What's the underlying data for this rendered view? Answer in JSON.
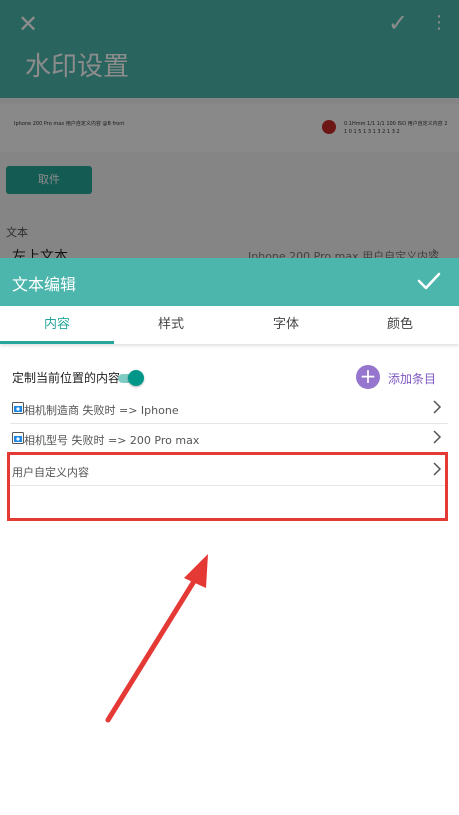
{
  "background_page": {
    "title": "水印设置",
    "preview_left_text": "Iphone 200 Pro max 用户自定义内容 @B front",
    "preview_right_text": "0.1Hmm 1/1 1/1 100 ISO 用户自定义内容 2 1 0 1 5 1 3 1 3 2 1 3 2",
    "button_label": "取件",
    "section_label": "文本",
    "row_label": "左上文本",
    "row_value": "Iphone 200 Pro max 用户自定义内容"
  },
  "sheet": {
    "title": "文本编辑",
    "tabs": [
      {
        "label": "内容",
        "active": true
      },
      {
        "label": "样式",
        "active": false
      },
      {
        "label": "字体",
        "active": false
      },
      {
        "label": "颜色",
        "active": false
      }
    ],
    "customize_label": "定制当前位置的内容",
    "customize_enabled": true,
    "add_item_label": "添加条目",
    "items": [
      {
        "text": "相机制造商 失败时 => Iphone",
        "icon": "camera-tag-icon"
      },
      {
        "text": "相机型号 失败时 => 200 Pro max",
        "icon": "camera-tag-icon"
      },
      {
        "text": "用户自定义内容",
        "icon": ""
      }
    ]
  },
  "colors": {
    "accent": "#4db6ac",
    "accent_dark": "#009688",
    "add_button": "#9575cd",
    "annotation_red": "#e53935"
  }
}
